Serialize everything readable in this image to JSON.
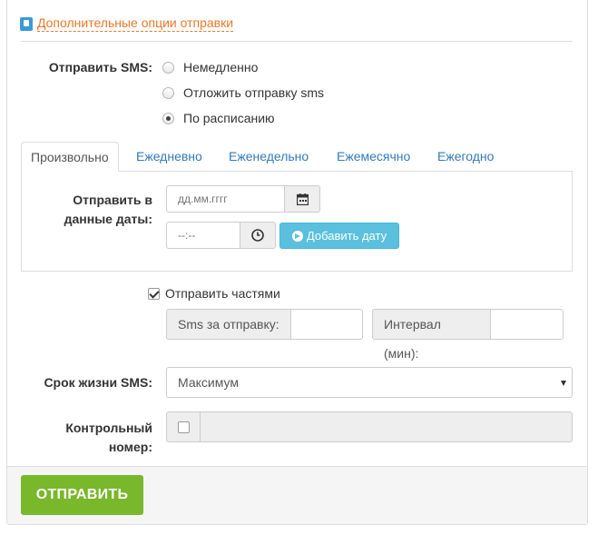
{
  "additional_options": {
    "link_label": "Дополнительные опции отправки"
  },
  "send_sms": {
    "label": "Отправить SMS:",
    "options": [
      "Немедленно",
      "Отложить отправку sms",
      "По расписанию"
    ],
    "selected": "По расписанию"
  },
  "tabs": [
    "Произвольно",
    "Ежедневно",
    "Еженедельно",
    "Ежемесячно",
    "Ежегодно"
  ],
  "active_tab": "Произвольно",
  "dates": {
    "label_line1": "Отправить в",
    "label_line2": "данные даты:",
    "date_placeholder": "дд.мм.гггг",
    "time_placeholder": "--:--",
    "add_date_button": "Добавить дату"
  },
  "parts": {
    "checkbox_label": "Отправить частями",
    "checked": true,
    "sms_per_send_label": "Sms за отправку:",
    "sms_per_send_value": "",
    "interval_label": "Интервал (мин):",
    "interval_value": ""
  },
  "lifetime": {
    "label": "Срок жизни SMS:",
    "selected": "Максимум"
  },
  "control_number": {
    "label_line1": "Контрольный",
    "label_line2": "номер:",
    "checked": false,
    "value": ""
  },
  "submit": {
    "label": "ОТПРАВИТЬ"
  },
  "colors": {
    "link_orange": "#e8782a",
    "tab_blue": "#337ab7",
    "info_button": "#5bc0de",
    "submit_green": "#78b82a"
  }
}
